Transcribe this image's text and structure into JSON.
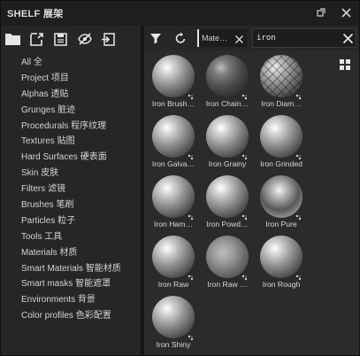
{
  "window": {
    "title": "SHELF 展架"
  },
  "left_toolbar": {
    "icons": [
      "folder-icon",
      "new-resource-icon",
      "save-icon",
      "hide-icon",
      "import-icon"
    ]
  },
  "categories": [
    "All 全",
    "Project 项目",
    "Alphas 透贴",
    "Grunges 脏迹",
    "Procedurals 程序纹理",
    "Textures 贴图",
    "Hard Surfaces 硬表面",
    "Skin 皮肤",
    "Filters 滤镜",
    "Brushes 笔刷",
    "Particles 粒子",
    "Tools 工具",
    "Materials 材质",
    "Smart Materials 智能材质",
    "Smart masks 智能遮罩",
    "Environments 背景",
    "Color profiles 色彩配置"
  ],
  "filter": {
    "chip_label": "Mate…",
    "search_value": "iron"
  },
  "materials": [
    {
      "label": "Iron Brush…",
      "style": "plain"
    },
    {
      "label": "Iron Chain…",
      "style": "dark"
    },
    {
      "label": "Iron Diam…",
      "style": "diamond"
    },
    {
      "label": "Iron Galva…",
      "style": "plain"
    },
    {
      "label": "Iron Grainy",
      "style": "plain"
    },
    {
      "label": "Iron Grinded",
      "style": "plain"
    },
    {
      "label": "Iron Ham…",
      "style": "plain"
    },
    {
      "label": "Iron Powd…",
      "style": "plain"
    },
    {
      "label": "Iron Pure",
      "style": "pure"
    },
    {
      "label": "Iron Raw",
      "style": "plain"
    },
    {
      "label": "Iron Raw …",
      "style": "rough"
    },
    {
      "label": "Iron Rough",
      "style": "plain"
    },
    {
      "label": "Iron Shiny",
      "style": "plain"
    }
  ],
  "colors": {
    "panel": "#262626",
    "grid_bg": "#2b2b2b",
    "accent": "#e6e6e6"
  }
}
